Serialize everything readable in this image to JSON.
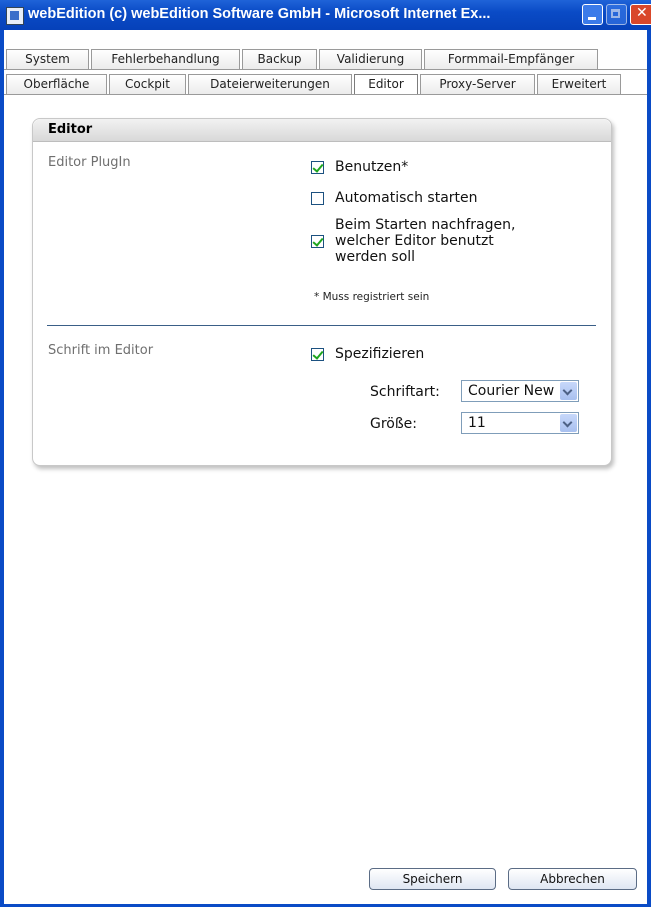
{
  "window": {
    "title": "webEdition (c) webEdition Software GmbH - Microsoft Internet Ex...",
    "icon": "ie-page-icon",
    "controls": [
      "minimize-icon",
      "maximize-icon",
      "close-icon"
    ]
  },
  "tabs": {
    "row1": [
      "System",
      "Fehlerbehandlung",
      "Backup",
      "Validierung",
      "Formmail-Empfänger"
    ],
    "row2": [
      "Oberfläche",
      "Cockpit",
      "Dateierweiterungen",
      "Editor",
      "Proxy-Server",
      "Erweitert"
    ],
    "active": "Editor"
  },
  "panel": {
    "title": "Editor",
    "plugin": {
      "label": "Editor PlugIn",
      "use": {
        "label": "Benutzen*",
        "checked": true
      },
      "autostart": {
        "label": "Automatisch starten",
        "checked": false
      },
      "ask": {
        "line1": "Beim Starten nachfragen,",
        "line2": "welcher Editor benutzt",
        "line3": "werden soll",
        "checked": true
      },
      "note": "* Muss registriert sein"
    },
    "font": {
      "label": "Schrift im Editor",
      "specify": {
        "label": "Spezifizieren",
        "checked": true
      },
      "fontface_label": "Schriftart:",
      "fontface_value": "Courier New",
      "size_label": "Größe:",
      "size_value": "11"
    }
  },
  "buttons": {
    "save": "Speichern",
    "cancel": "Abbrechen"
  },
  "colors": {
    "titlebar": "#0a4bc6",
    "divider": "#3a5f87",
    "checkmark": "#1fa61f"
  }
}
